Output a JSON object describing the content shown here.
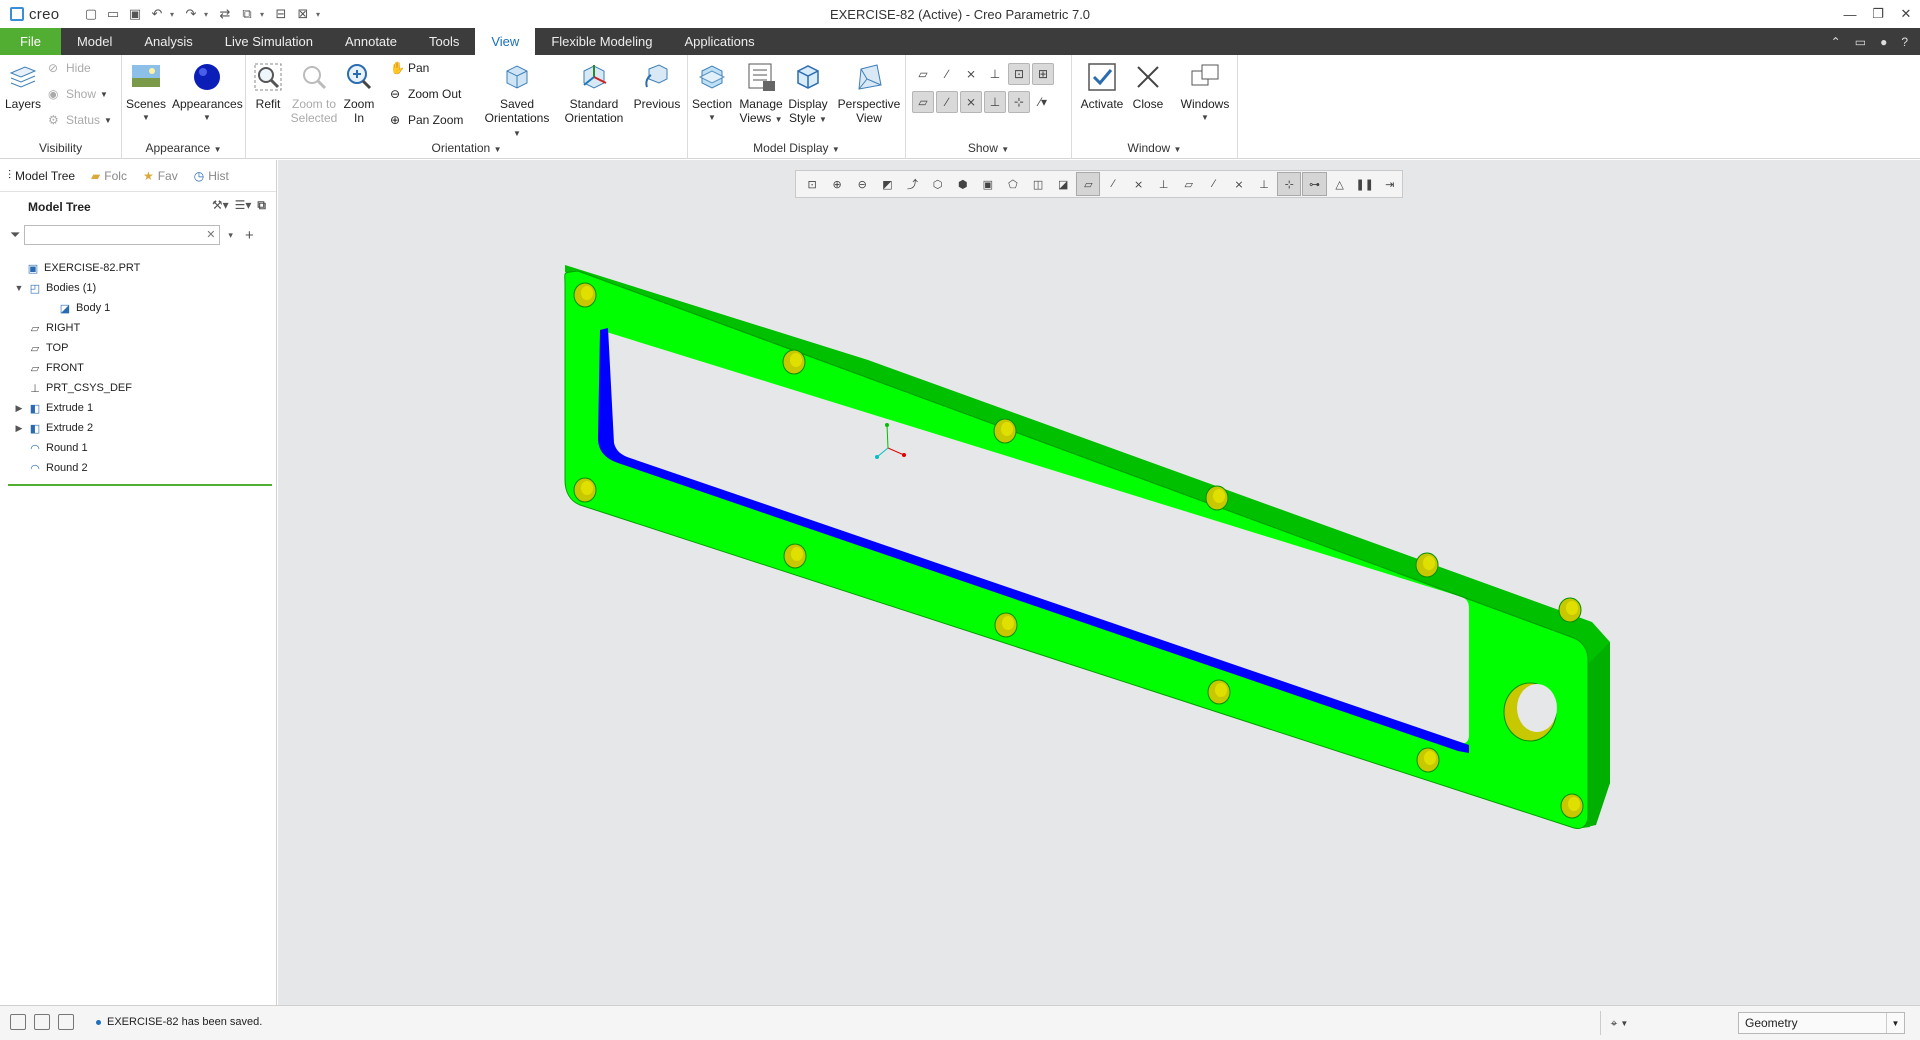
{
  "window": {
    "app_logo": "creo",
    "title": "EXERCISE-82 (Active) - Creo Parametric 7.0",
    "controls": [
      "minimize-icon",
      "restore-icon",
      "close-icon"
    ]
  },
  "tabs": [
    {
      "label": "File"
    },
    {
      "label": "Model"
    },
    {
      "label": "Analysis"
    },
    {
      "label": "Live Simulation"
    },
    {
      "label": "Annotate"
    },
    {
      "label": "Tools"
    },
    {
      "label": "View"
    },
    {
      "label": "Flexible Modeling"
    },
    {
      "label": "Applications"
    }
  ],
  "active_tab": "View",
  "ribbon": {
    "visibility": {
      "layers": "Layers",
      "hide": "Hide",
      "show": "Show",
      "status": "Status",
      "label": "Visibility"
    },
    "appearance": {
      "scenes": "Scenes",
      "appearances": "Appearances",
      "label": "Appearance"
    },
    "orientation": {
      "refit": "Refit",
      "zoom_to_selected_1": "Zoom to",
      "zoom_to_selected_2": "Selected",
      "zoom_in_1": "Zoom",
      "zoom_in_2": "In",
      "pan": "Pan",
      "zoom_out": "Zoom Out",
      "pan_zoom": "Pan Zoom",
      "saved_1": "Saved",
      "saved_2": "Orientations",
      "standard_1": "Standard",
      "standard_2": "Orientation",
      "previous": "Previous",
      "label": "Orientation"
    },
    "model_display": {
      "section": "Section",
      "manage_1": "Manage",
      "manage_2": "Views",
      "display_1": "Display",
      "display_2": "Style",
      "perspective_1": "Perspective",
      "perspective_2": "View",
      "label": "Model Display"
    },
    "show": {
      "label": "Show"
    },
    "window": {
      "activate": "Activate",
      "close": "Close",
      "windows": "Windows",
      "label": "Window"
    }
  },
  "navigator": {
    "tabs": [
      "Model Tree",
      "Folc",
      "Fav",
      "Hist"
    ],
    "tree_title": "Model Tree",
    "filter_placeholder": "",
    "nodes": [
      {
        "label": "EXERCISE-82.PRT",
        "icon": "part-icon",
        "indent": 0,
        "expander": ""
      },
      {
        "label": "Bodies (1)",
        "icon": "bodies-icon",
        "indent": 1,
        "expander": "▼"
      },
      {
        "label": "Body 1",
        "icon": "body-icon",
        "indent": 2,
        "expander": ""
      },
      {
        "label": "RIGHT",
        "icon": "datum-plane-icon",
        "indent": 1,
        "expander": ""
      },
      {
        "label": "TOP",
        "icon": "datum-plane-icon",
        "indent": 1,
        "expander": ""
      },
      {
        "label": "FRONT",
        "icon": "datum-plane-icon",
        "indent": 1,
        "expander": ""
      },
      {
        "label": "PRT_CSYS_DEF",
        "icon": "csys-icon",
        "indent": 1,
        "expander": ""
      },
      {
        "label": "Extrude 1",
        "icon": "extrude-icon",
        "indent": 1,
        "expander": "▶"
      },
      {
        "label": "Extrude 2",
        "icon": "extrude-icon",
        "indent": 1,
        "expander": "▶"
      },
      {
        "label": "Round 1",
        "icon": "round-icon",
        "indent": 1,
        "expander": ""
      },
      {
        "label": "Round 2",
        "icon": "round-icon",
        "indent": 1,
        "expander": ""
      }
    ]
  },
  "status": {
    "message": "EXERCISE-82 has been saved.",
    "filter_value": "Geometry"
  },
  "colors": {
    "part_green": "#00ff00",
    "inner_wall_blue": "#0000ff",
    "hole_yellow": "#c8c800",
    "file_tab": "#52ae32",
    "viewport_bg": "#e6e7e8"
  }
}
